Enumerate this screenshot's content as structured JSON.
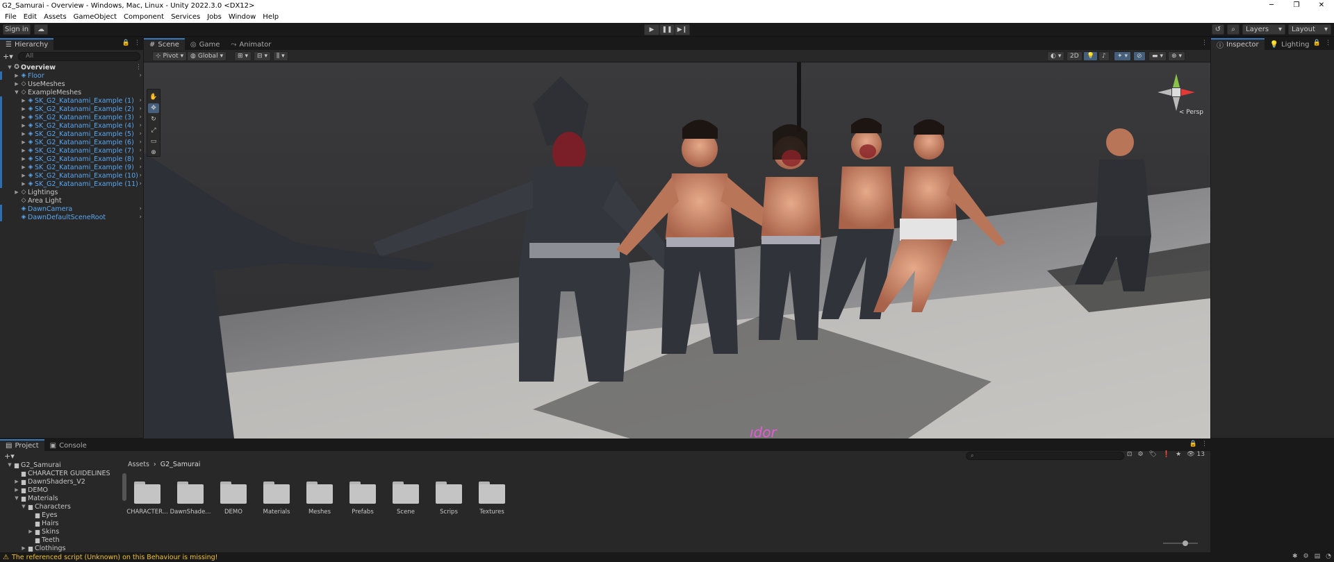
{
  "window": {
    "title": "G2_Samurai - Overview - Windows, Mac, Linux - Unity 2022.3.0 <DX12>",
    "controls": {
      "minimize": "─",
      "restore": "❐",
      "close": "✕"
    }
  },
  "menu": [
    "File",
    "Edit",
    "Assets",
    "GameObject",
    "Component",
    "Services",
    "Jobs",
    "Window",
    "Help"
  ],
  "toolbar": {
    "sign_in": "Sign in",
    "cloud_icon": "☁",
    "play": "▶",
    "pause": "❚❚",
    "step": "▶❙",
    "history_icon": "↺",
    "search_icon": "⌕",
    "layers": "Layers",
    "layout": "Layout"
  },
  "hierarchy": {
    "tab": "Hierarchy",
    "search_placeholder": "All",
    "add": "+▾",
    "items": [
      {
        "label": "Overview",
        "indent": 0,
        "arrow": "▼",
        "icon": "✪",
        "style": "scene"
      },
      {
        "label": "Floor",
        "indent": 1,
        "arrow": "▶",
        "icon": "◈",
        "style": "blue"
      },
      {
        "label": "UseMeshes",
        "indent": 1,
        "arrow": "▶",
        "icon": "◇",
        "style": "grey"
      },
      {
        "label": "ExampleMeshes",
        "indent": 1,
        "arrow": "▼",
        "icon": "◇",
        "style": "grey"
      },
      {
        "label": "SK_G2_Katanami_Example (1)",
        "indent": 2,
        "arrow": "▶",
        "icon": "◈",
        "style": "blue"
      },
      {
        "label": "SK_G2_Katanami_Example (2)",
        "indent": 2,
        "arrow": "▶",
        "icon": "◈",
        "style": "blue"
      },
      {
        "label": "SK_G2_Katanami_Example (3)",
        "indent": 2,
        "arrow": "▶",
        "icon": "◈",
        "style": "blue"
      },
      {
        "label": "SK_G2_Katanami_Example (4)",
        "indent": 2,
        "arrow": "▶",
        "icon": "◈",
        "style": "blue"
      },
      {
        "label": "SK_G2_Katanami_Example (5)",
        "indent": 2,
        "arrow": "▶",
        "icon": "◈",
        "style": "blue"
      },
      {
        "label": "SK_G2_Katanami_Example (6)",
        "indent": 2,
        "arrow": "▶",
        "icon": "◈",
        "style": "blue"
      },
      {
        "label": "SK_G2_Katanami_Example (7)",
        "indent": 2,
        "arrow": "▶",
        "icon": "◈",
        "style": "blue"
      },
      {
        "label": "SK_G2_Katanami_Example (8)",
        "indent": 2,
        "arrow": "▶",
        "icon": "◈",
        "style": "blue"
      },
      {
        "label": "SK_G2_Katanami_Example (9)",
        "indent": 2,
        "arrow": "▶",
        "icon": "◈",
        "style": "blue"
      },
      {
        "label": "SK_G2_Katanami_Example (10)",
        "indent": 2,
        "arrow": "▶",
        "icon": "◈",
        "style": "blue"
      },
      {
        "label": "SK_G2_Katanami_Example (11)",
        "indent": 2,
        "arrow": "▶",
        "icon": "◈",
        "style": "blue"
      },
      {
        "label": "Lightings",
        "indent": 1,
        "arrow": "▶",
        "icon": "◇",
        "style": "grey"
      },
      {
        "label": "Area Light",
        "indent": 1,
        "arrow": "",
        "icon": "◇",
        "style": "grey"
      },
      {
        "label": "DawnCamera",
        "indent": 1,
        "arrow": "",
        "icon": "◈",
        "style": "blue"
      },
      {
        "label": "DawnDefaultSceneRoot",
        "indent": 1,
        "arrow": "",
        "icon": "◈",
        "style": "blue"
      }
    ]
  },
  "scene": {
    "tabs": [
      {
        "label": "Scene",
        "icon": "#"
      },
      {
        "label": "Game",
        "icon": "◎"
      },
      {
        "label": "Animator",
        "icon": "⤳"
      }
    ],
    "pivot": "Pivot",
    "global": "Global",
    "view_2d": "2D",
    "persp": "< Persp",
    "tools": [
      "✋",
      "✥",
      "↻",
      "⤢",
      "▭",
      "⊕"
    ]
  },
  "inspector": {
    "tabs": [
      {
        "label": "Inspector",
        "icon": "ⓘ"
      },
      {
        "label": "Lighting",
        "icon": "💡"
      }
    ]
  },
  "project": {
    "tabs": [
      {
        "label": "Project",
        "icon": "▤"
      },
      {
        "label": "Console",
        "icon": "▣"
      }
    ],
    "tree": [
      {
        "label": "G2_Samurai",
        "indent": 0,
        "arrow": "▼"
      },
      {
        "label": "CHARACTER GUIDELINES",
        "indent": 1,
        "arrow": ""
      },
      {
        "label": "DawnShaders_V2",
        "indent": 1,
        "arrow": "▶"
      },
      {
        "label": "DEMO",
        "indent": 1,
        "arrow": "▶"
      },
      {
        "label": "Materials",
        "indent": 1,
        "arrow": "▼"
      },
      {
        "label": "Characters",
        "indent": 2,
        "arrow": "▼"
      },
      {
        "label": "Eyes",
        "indent": 3,
        "arrow": ""
      },
      {
        "label": "Hairs",
        "indent": 3,
        "arrow": ""
      },
      {
        "label": "Skins",
        "indent": 3,
        "arrow": "▶"
      },
      {
        "label": "Teeth",
        "indent": 3,
        "arrow": ""
      },
      {
        "label": "Clothings",
        "indent": 2,
        "arrow": "▶"
      }
    ],
    "breadcrumb": [
      "Assets",
      "G2_Samurai"
    ],
    "hidden_count": "13",
    "folders": [
      "CHARACTER...",
      "DawnShade...",
      "DEMO",
      "Materials",
      "Meshes",
      "Prefabs",
      "Scene",
      "Scrips",
      "Textures"
    ]
  },
  "status": {
    "warning_icon": "⚠",
    "message": "The referenced script (Unknown) on this Behaviour is missing!"
  },
  "colors": {
    "accent": "#3a79bb",
    "prefab_blue": "#5aa8f2",
    "warning": "#f1c232"
  }
}
